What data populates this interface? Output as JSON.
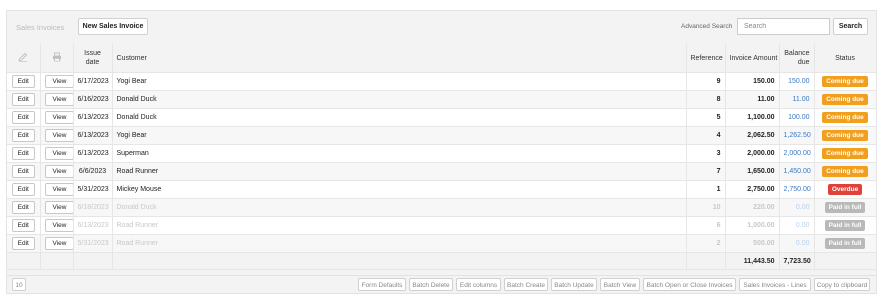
{
  "header": {
    "title": "Sales Invoices",
    "new_button": "New Sales Invoice",
    "advanced_search": "Advanced Search",
    "search_placeholder": "Search",
    "search_button": "Search"
  },
  "columns": {
    "edit_icon": "pencil-icon",
    "view_icon": "printer-icon",
    "issue_date": "Issue date",
    "customer": "Customer",
    "reference": "Reference",
    "invoice_amount": "Invoice Amount",
    "balance_due": "Balance due",
    "status": "Status"
  },
  "row_buttons": {
    "edit": "Edit",
    "view": "View"
  },
  "rows": [
    {
      "date": "6/17/2023",
      "customer": "Yogi Bear",
      "ref": "9",
      "amount": "150.00",
      "balance": "150.00",
      "status": "Coming due",
      "status_color": "#f0a01e",
      "faded": false
    },
    {
      "date": "6/16/2023",
      "customer": "Donald Duck",
      "ref": "8",
      "amount": "11.00",
      "balance": "11.00",
      "status": "Coming due",
      "status_color": "#f0a01e",
      "faded": false
    },
    {
      "date": "6/13/2023",
      "customer": "Donald Duck",
      "ref": "5",
      "amount": "1,100.00",
      "balance": "100.00",
      "status": "Coming due",
      "status_color": "#f0a01e",
      "faded": false
    },
    {
      "date": "6/13/2023",
      "customer": "Yogi Bear",
      "ref": "4",
      "amount": "2,062.50",
      "balance": "1,262.50",
      "status": "Coming due",
      "status_color": "#f0a01e",
      "faded": false
    },
    {
      "date": "6/13/2023",
      "customer": "Superman",
      "ref": "3",
      "amount": "2,000.00",
      "balance": "2,000.00",
      "status": "Coming due",
      "status_color": "#f0a01e",
      "faded": false
    },
    {
      "date": "6/6/2023",
      "customer": "Road Runner",
      "ref": "7",
      "amount": "1,650.00",
      "balance": "1,450.00",
      "status": "Coming due",
      "status_color": "#f0a01e",
      "faded": false
    },
    {
      "date": "5/31/2023",
      "customer": "Mickey Mouse",
      "ref": "1",
      "amount": "2,750.00",
      "balance": "2,750.00",
      "status": "Overdue",
      "status_color": "#e0413a",
      "faded": false
    },
    {
      "date": "6/18/2023",
      "customer": "Donald Duck",
      "ref": "10",
      "amount": "220.00",
      "balance": "0.00",
      "status": "Paid in full",
      "status_color": "#b9b9b9",
      "faded": true
    },
    {
      "date": "6/13/2023",
      "customer": "Road Runner",
      "ref": "6",
      "amount": "1,000.00",
      "balance": "0.00",
      "status": "Paid in full",
      "status_color": "#b9b9b9",
      "faded": true
    },
    {
      "date": "5/31/2023",
      "customer": "Road Runner",
      "ref": "2",
      "amount": "500.00",
      "balance": "0.00",
      "status": "Paid in full",
      "status_color": "#b9b9b9",
      "faded": true
    }
  ],
  "totals": {
    "amount": "11,443.50",
    "balance": "7,723.50"
  },
  "footer": {
    "page_size": "10",
    "buttons": [
      "Form Defaults",
      "Batch Delete",
      "Edit columns",
      "Batch Create",
      "Batch Update",
      "Batch View",
      "Batch Open or Close Invoices",
      "Sales Invoices - Lines",
      "Copy to clipboard"
    ]
  }
}
